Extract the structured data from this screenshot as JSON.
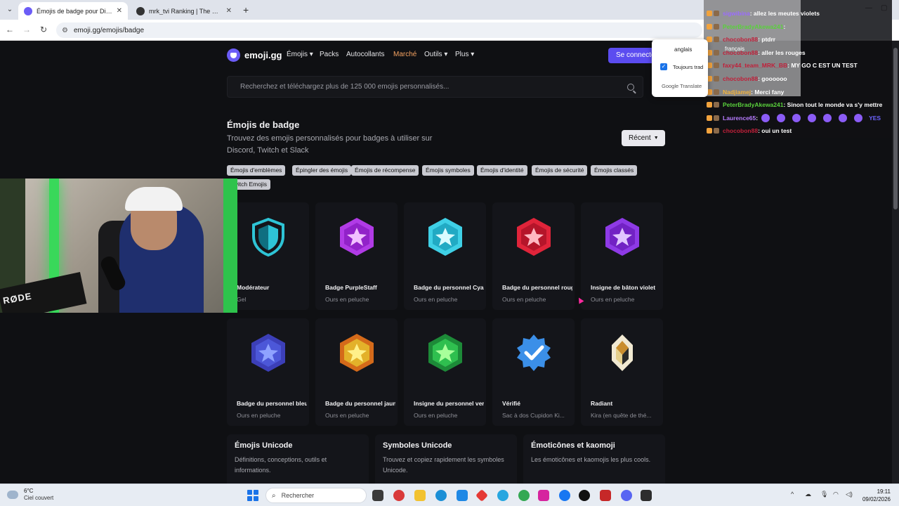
{
  "browser": {
    "tabs": [
      {
        "title": "Émojis de badge pour Discord",
        "active": true,
        "favicon_color": "#6b5cf6"
      },
      {
        "title": "mrk_tvi Ranking | The best Cha",
        "active": false,
        "favicon_color": "#333333"
      }
    ],
    "url": "emoji.gg/emojis/badge"
  },
  "site": {
    "logo_text": "emoji.gg",
    "nav": [
      {
        "label": "Émojis ▾",
        "dropdown": true
      },
      {
        "label": "Packs",
        "dropdown": false
      },
      {
        "label": "Autocollants",
        "dropdown": false
      },
      {
        "label": "Marché",
        "dropdown": false
      },
      {
        "label": "Outils ▾",
        "dropdown": true
      },
      {
        "label": "Plus ▾",
        "dropdown": true
      }
    ],
    "connect_label": "Se connecter",
    "search_placeholder": "Recherchez et téléchargez plus de 125 000 emojis personnalisés...",
    "accent_color": "#5b4cf0",
    "market_color": "#f4a261"
  },
  "page": {
    "title": "Émojis de badge",
    "description": "Trouvez des emojis personnalisés pour badges à utiliser sur Discord, Twitch et Slack",
    "sort_label": "Récent",
    "chips": [
      "Émojis d'emblèmes",
      "Épingler des émojis",
      "Émojis de récompense",
      "Émojis symboles",
      "Émojis d'identité",
      "Émojis de sécurité",
      "Émojis classés",
      "Twitch Emojis"
    ],
    "cards": [
      {
        "name": "Modérateur",
        "pack": "Gel",
        "icon": "shield-icon",
        "color": "#2ec4d6"
      },
      {
        "name": "Badge PurpleStaff",
        "pack": "Ours en peluche",
        "icon": "purple-star-badge-icon",
        "color": "#b13be6"
      },
      {
        "name": "Badge du personnel Cyan",
        "pack": "Ours en peluche",
        "icon": "cyan-star-badge-icon",
        "color": "#3fd0e6"
      },
      {
        "name": "Badge du personnel rouge",
        "pack": "Ours en peluche",
        "icon": "red-star-badge-icon",
        "color": "#e0243a"
      },
      {
        "name": "Insigne de bâton violet",
        "pack": "Ours en peluche",
        "icon": "violet-star-badge-icon",
        "color": "#8e3ae6"
      },
      {
        "name": "Badge du personnel bleu",
        "pack": "Ours en peluche",
        "icon": "blue-star-badge-icon",
        "color": "#4c57d8"
      },
      {
        "name": "Badge du personnel jaune",
        "pack": "Ours en peluche",
        "icon": "yellow-star-badge-icon",
        "color": "#e3b12a"
      },
      {
        "name": "Insigne du personnel vert",
        "pack": "Ours en peluche",
        "icon": "green-star-badge-icon",
        "color": "#2fbf4f"
      },
      {
        "name": "Vérifié",
        "pack": "Sac à dos Cupidon Ki...",
        "icon": "verified-check-icon",
        "color": "#3b8fe8"
      },
      {
        "name": "Radiant",
        "pack": "Kira (en quête de thé...",
        "icon": "radiant-rank-icon",
        "color": "#e8d9b0"
      }
    ],
    "features": [
      {
        "title": "Émojis Unicode",
        "desc": "Définitions, conceptions, outils et informations."
      },
      {
        "title": "Symboles Unicode",
        "desc": "Trouvez et copiez rapidement les symboles Unicode."
      },
      {
        "title": "Émoticônes et kaomoji",
        "desc": "Les émoticônes et kaomojis les plus cools."
      }
    ]
  },
  "translate_popup": {
    "lang_from": "anglais",
    "lang_to": "français",
    "always_label": "Toujours trad",
    "brand": "Google Translate"
  },
  "chat": {
    "lines": [
      {
        "user": "sigwibina",
        "user_color": "#9b6bff",
        "msg": ": allez les meutes violets"
      },
      {
        "user": "PeterBradyAkewa241",
        "user_color": "#5ad13c",
        "msg": ":"
      },
      {
        "user": "chocobon88",
        "user_color": "#c0203a",
        "msg": ": ptdrr"
      },
      {
        "user": "chocobon88",
        "user_color": "#c0203a",
        "msg": ": aller les rouges"
      },
      {
        "user": "faxy44_team_MRK_BB",
        "user_color": "#c0203a",
        "msg": ": MY GO C EST UN TEST"
      },
      {
        "user": "chocobon88",
        "user_color": "#c0203a",
        "msg": ": goooooo"
      },
      {
        "user": "Nadjiamej",
        "user_color": "#f2b33d",
        "msg": ": Merci fany"
      },
      {
        "user": "PeterBradyAkewa241",
        "user_color": "#5ad13c",
        "msg": ": Sinon tout le monde va s'y mettre"
      },
      {
        "user": "Laurence65",
        "user_color": "#b77cff",
        "msg": ":"
      },
      {
        "user": "chocobon88",
        "user_color": "#c0203a",
        "msg": ": oui un test"
      }
    ],
    "emote_trailer": "YES"
  },
  "taskbar": {
    "temperature": "6°C",
    "condition": "Ciel couvert",
    "search_label": "Rechercher",
    "time": "19:11",
    "date": "09/02/2026"
  },
  "webcam": {
    "mic_brand": "RØDE"
  }
}
